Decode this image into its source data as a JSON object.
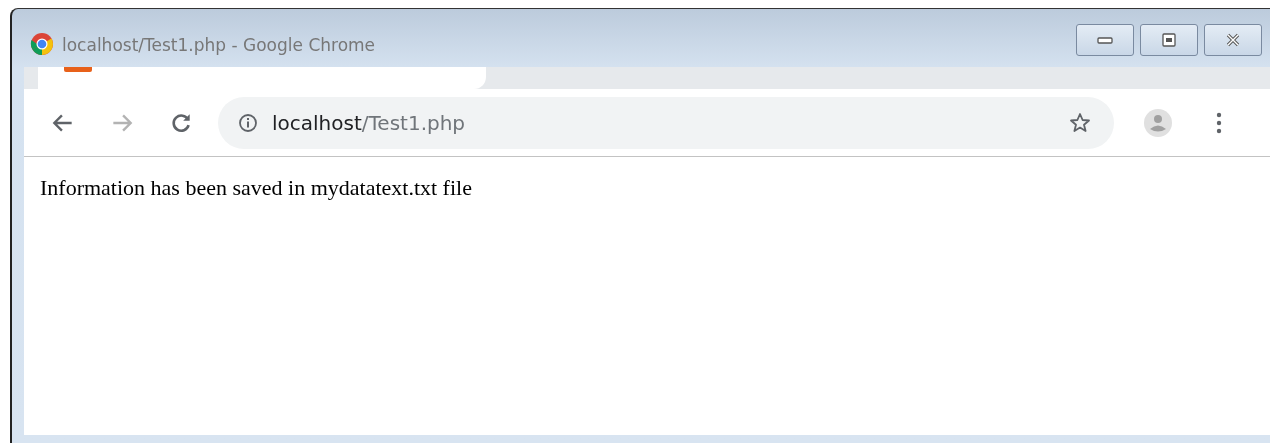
{
  "window": {
    "title": "localhost/Test1.php - Google Chrome"
  },
  "toolbar": {
    "back_disabled": false,
    "forward_disabled": true
  },
  "address_bar": {
    "host": "localhost",
    "path": "/Test1.php",
    "bookmarked": false
  },
  "page": {
    "text": "Information has been saved in mydatatext.txt file"
  }
}
